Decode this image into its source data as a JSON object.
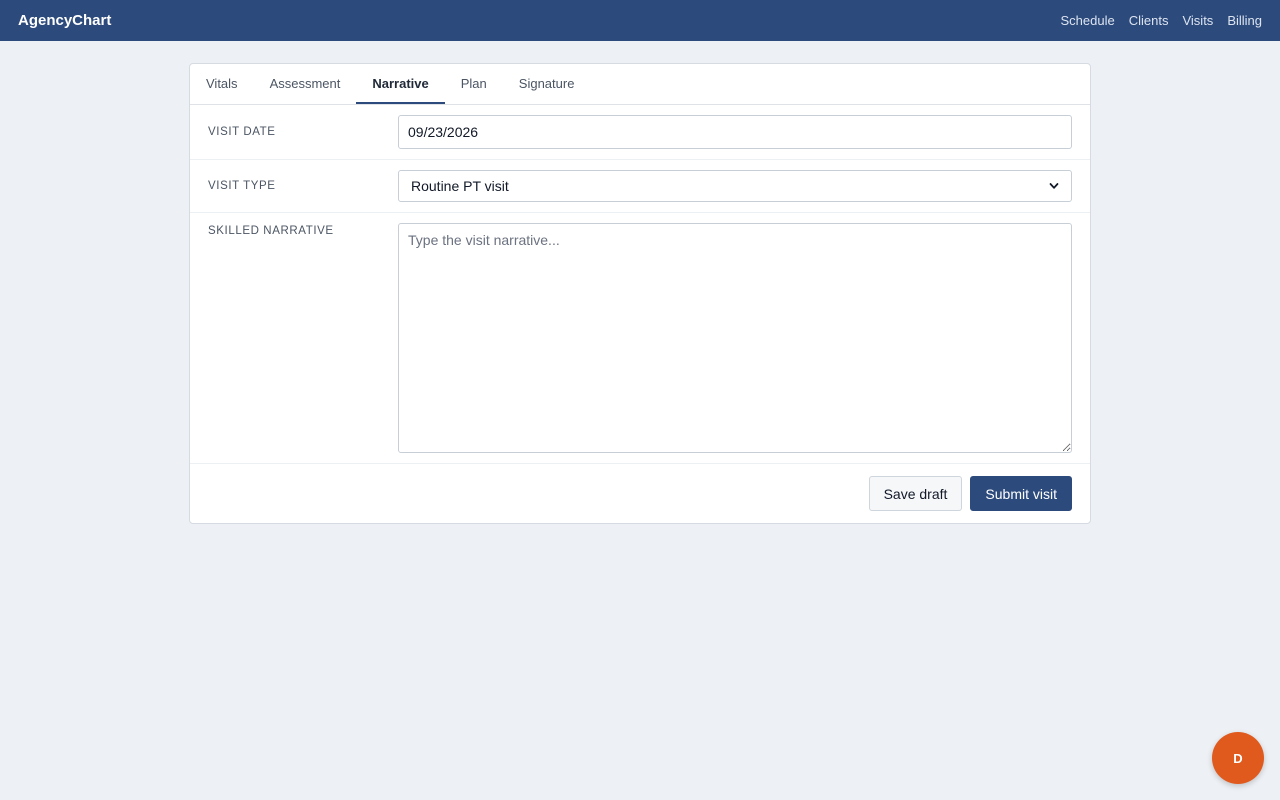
{
  "app": {
    "brand": "AgencyChart",
    "nav": [
      "Schedule",
      "Clients",
      "Visits",
      "Billing"
    ]
  },
  "tabs": [
    {
      "label": "Vitals",
      "active": false
    },
    {
      "label": "Assessment",
      "active": false
    },
    {
      "label": "Narrative",
      "active": true
    },
    {
      "label": "Plan",
      "active": false
    },
    {
      "label": "Signature",
      "active": false
    }
  ],
  "form": {
    "visit_date": {
      "label": "VISIT DATE",
      "value": "09/23/2026"
    },
    "visit_type": {
      "label": "VISIT TYPE",
      "value": "Routine PT visit"
    },
    "narrative": {
      "label": "SKILLED NARRATIVE",
      "value": "",
      "placeholder": "Type the visit narrative..."
    }
  },
  "actions": {
    "save_label": "Save draft",
    "submit_label": "Submit visit"
  },
  "avatar": {
    "initial": "D"
  },
  "colors": {
    "header": "#2c4a7c",
    "primary": "#2c4a7c",
    "avatar": "#e05a1e",
    "background": "#edf0f4"
  }
}
